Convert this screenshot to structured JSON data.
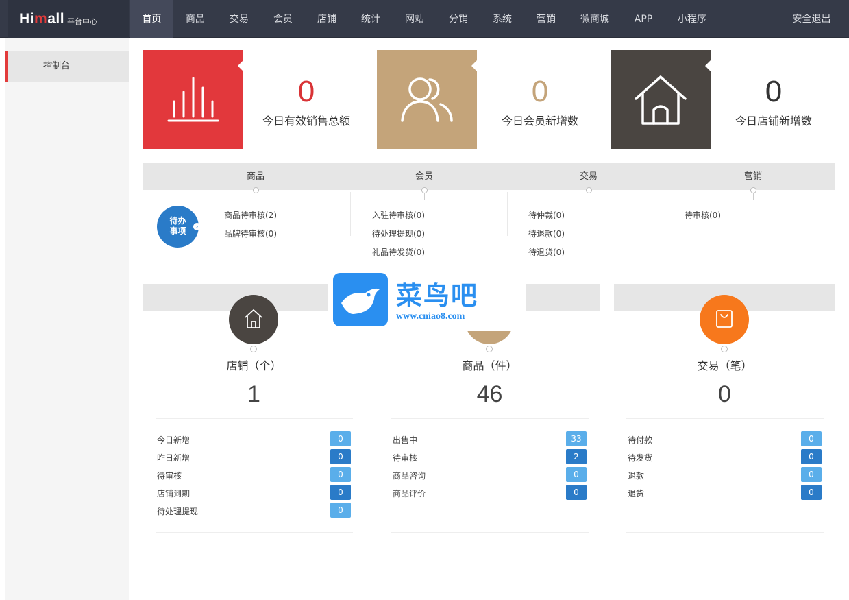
{
  "header": {
    "brand_pre": "Hi",
    "brand_mid": "m",
    "brand_post": "all",
    "brand_sub": "平台中心",
    "nav": [
      "首页",
      "商品",
      "交易",
      "会员",
      "店铺",
      "统计",
      "网站",
      "分销",
      "系统",
      "营销",
      "微商城",
      "APP",
      "小程序"
    ],
    "active": "首页",
    "logout": "安全退出"
  },
  "sidebar": {
    "items": [
      {
        "label": "控制台"
      }
    ]
  },
  "stats": [
    {
      "value": "0",
      "label": "今日有效销售总额",
      "icon": "bar-chart-icon",
      "tile_color": "#e2383c",
      "num_color": "#d93336"
    },
    {
      "value": "0",
      "label": "今日会员新增数",
      "icon": "users-icon",
      "tile_color": "#c4a47a",
      "num_color": "#c4a47a"
    },
    {
      "value": "0",
      "label": "今日店铺新增数",
      "icon": "house-icon",
      "tile_color": "#4a4541",
      "num_color": "#333333"
    }
  ],
  "todo": {
    "badge_line1": "待办",
    "badge_line2": "事项",
    "heads": [
      "商品",
      "会员",
      "交易",
      "营销"
    ],
    "cols": [
      [
        "商品待审核(2)",
        "品牌待审核(0)"
      ],
      [
        "入驻待审核(0)",
        "待处理提现(0)",
        "礼品待发货(0)"
      ],
      [
        "待仲裁(0)",
        "待退款(0)",
        "待退货(0)"
      ],
      [
        "待审核(0)"
      ]
    ]
  },
  "watermark": {
    "cn": "菜鸟吧",
    "url": "www.cniao8.com"
  },
  "panels": [
    {
      "title": "店铺（个）",
      "value": "1",
      "icon": "store-icon",
      "color": "#4a4541",
      "rows": [
        {
          "label": "今日新增",
          "value": "0"
        },
        {
          "label": "昨日新增",
          "value": "0"
        },
        {
          "label": "待审核",
          "value": "0"
        },
        {
          "label": "店铺到期",
          "value": "0"
        },
        {
          "label": "待处理提现",
          "value": "0"
        }
      ]
    },
    {
      "title": "商品（件）",
      "value": "46",
      "icon": "product-icon",
      "color": "#c4a47a",
      "rows": [
        {
          "label": "出售中",
          "value": "33"
        },
        {
          "label": "待审核",
          "value": "2"
        },
        {
          "label": "商品咨询",
          "value": "0"
        },
        {
          "label": "商品评价",
          "value": "0"
        }
      ]
    },
    {
      "title": "交易（笔）",
      "value": "0",
      "icon": "shopping-bag-icon",
      "color": "#f7781c",
      "rows": [
        {
          "label": "待付款",
          "value": "0"
        },
        {
          "label": "待发货",
          "value": "0"
        },
        {
          "label": "退款",
          "value": "0"
        },
        {
          "label": "退货",
          "value": "0"
        }
      ]
    }
  ]
}
